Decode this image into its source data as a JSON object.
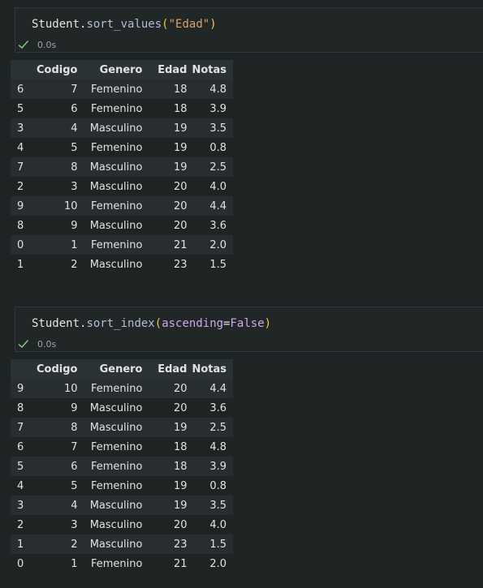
{
  "cells": [
    {
      "code": {
        "object": "Student",
        "dot": ".",
        "method": "sort_values",
        "open_paren": "(",
        "argument_string": "\"Edad\"",
        "close_paren": ")"
      },
      "status": {
        "icon": "check-icon",
        "time": "0.0s",
        "color": "#89d185"
      },
      "table": {
        "columns": [
          "",
          "Codigo",
          "Genero",
          "Edad",
          "Notas"
        ],
        "rows": [
          [
            "6",
            "7",
            "Femenino",
            "18",
            "4.8"
          ],
          [
            "5",
            "6",
            "Femenino",
            "18",
            "3.9"
          ],
          [
            "3",
            "4",
            "Masculino",
            "19",
            "3.5"
          ],
          [
            "4",
            "5",
            "Femenino",
            "19",
            "0.8"
          ],
          [
            "7",
            "8",
            "Masculino",
            "19",
            "2.5"
          ],
          [
            "2",
            "3",
            "Masculino",
            "20",
            "4.0"
          ],
          [
            "9",
            "10",
            "Femenino",
            "20",
            "4.4"
          ],
          [
            "8",
            "9",
            "Masculino",
            "20",
            "3.6"
          ],
          [
            "0",
            "1",
            "Femenino",
            "21",
            "2.0"
          ],
          [
            "1",
            "2",
            "Masculino",
            "23",
            "1.5"
          ]
        ]
      }
    },
    {
      "code": {
        "object": "Student",
        "dot": ".",
        "method": "sort_index",
        "open_paren": "(",
        "kwarg_name": "ascending",
        "equals": "=",
        "kwarg_value": "False",
        "close_paren": ")"
      },
      "status": {
        "icon": "check-icon",
        "time": "0.0s",
        "color": "#89d185"
      },
      "table": {
        "columns": [
          "",
          "Codigo",
          "Genero",
          "Edad",
          "Notas"
        ],
        "rows": [
          [
            "9",
            "10",
            "Femenino",
            "20",
            "4.4"
          ],
          [
            "8",
            "9",
            "Masculino",
            "20",
            "3.6"
          ],
          [
            "7",
            "8",
            "Masculino",
            "19",
            "2.5"
          ],
          [
            "6",
            "7",
            "Femenino",
            "18",
            "4.8"
          ],
          [
            "5",
            "6",
            "Femenino",
            "18",
            "3.9"
          ],
          [
            "4",
            "5",
            "Femenino",
            "19",
            "0.8"
          ],
          [
            "3",
            "4",
            "Masculino",
            "19",
            "3.5"
          ],
          [
            "2",
            "3",
            "Masculino",
            "20",
            "4.0"
          ],
          [
            "1",
            "2",
            "Masculino",
            "23",
            "1.5"
          ],
          [
            "0",
            "1",
            "Femenino",
            "21",
            "2.0"
          ]
        ]
      }
    }
  ]
}
